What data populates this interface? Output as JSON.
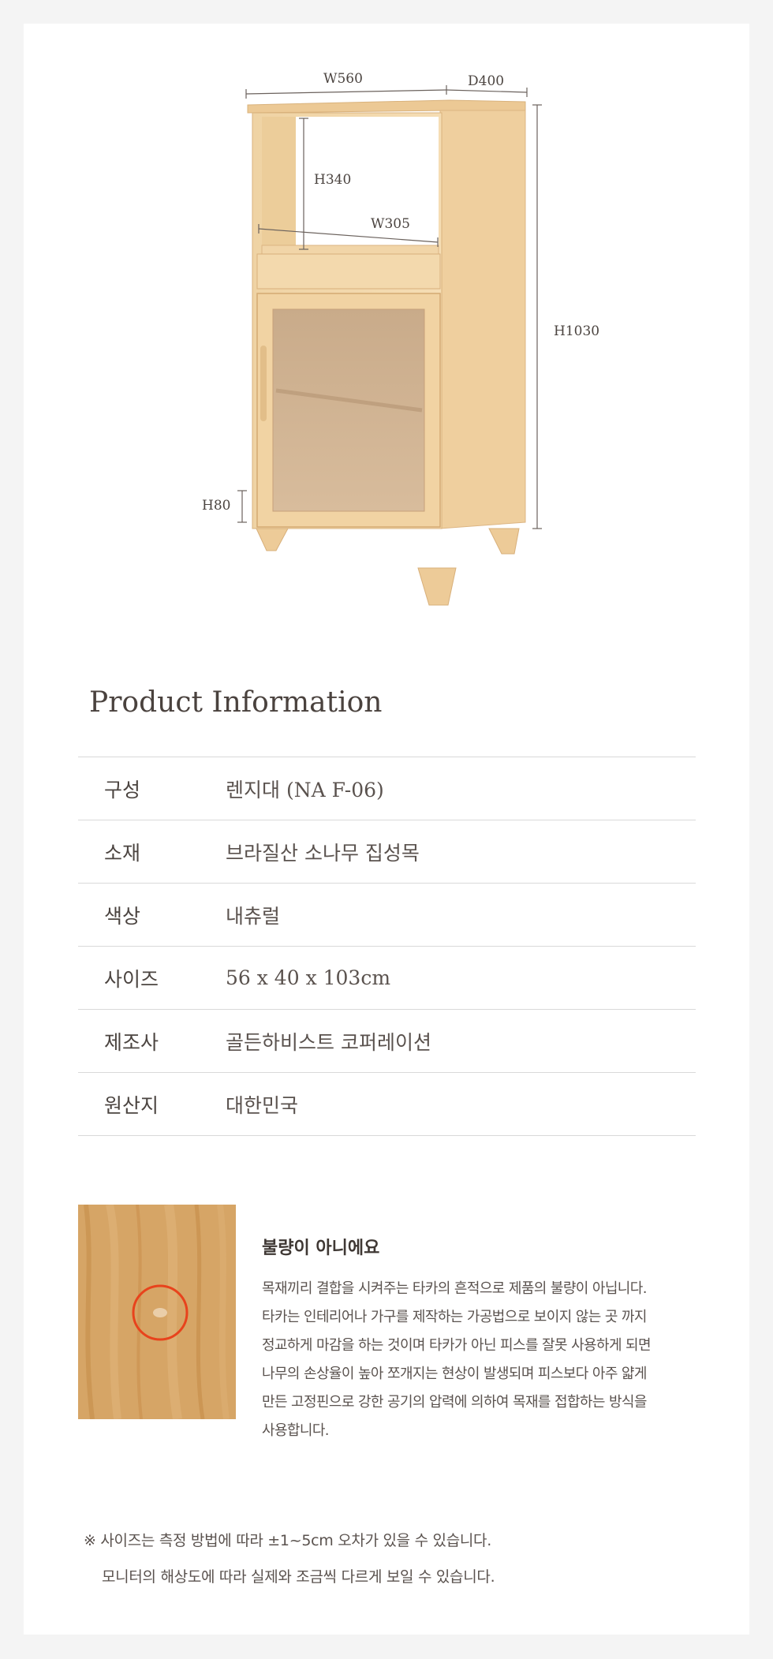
{
  "dimensions": {
    "width_total": "W560",
    "depth": "D400",
    "height_total": "H1030",
    "inner_height": "H340",
    "inner_width": "W305",
    "leg_height": "H80"
  },
  "product_info": {
    "title": "Product Information",
    "rows": [
      {
        "label": "구성",
        "value": "렌지대 (NA F-06)"
      },
      {
        "label": "소재",
        "value": "브라질산 소나무 집성목"
      },
      {
        "label": "색상",
        "value": "내츄럴"
      },
      {
        "label": "사이즈",
        "value": "56 x 40 x 103cm"
      },
      {
        "label": "제조사",
        "value": "골든하비스트 코퍼레이션"
      },
      {
        "label": "원산지",
        "value": "대한민국"
      }
    ]
  },
  "notice": {
    "title": "불량이 아니에요",
    "lines": [
      "목재끼리 결합을 시켜주는 타카의 흔적으로 제품의 불량이 아닙니다.",
      "타카는 인테리어나 가구를 제작하는 가공법으로 보이지 않는 곳 까지",
      "정교하게 마감을 하는 것이며 타카가 아닌 피스를 잘못 사용하게 되면",
      "나무의 손상율이 높아 쪼개지는 현상이 발생되며 피스보다 아주 얇게",
      "만든 고정핀으로 강한 공기의 압력에 의하여 목재를 접합하는 방식을",
      "사용합니다."
    ]
  },
  "footer": {
    "line1": "※ 사이즈는 측정 방법에 따라 ±1~5cm 오차가 있을 수 있습니다.",
    "line2": "모니터의 해상도에 따라 실제와 조금씩 다르게 보일 수 있습니다."
  },
  "colors": {
    "background": "#f4f4f4",
    "wood_light": "#f0d5a8",
    "wood_shade": "#e2bf8a",
    "highlight_circle": "#e8431c"
  }
}
